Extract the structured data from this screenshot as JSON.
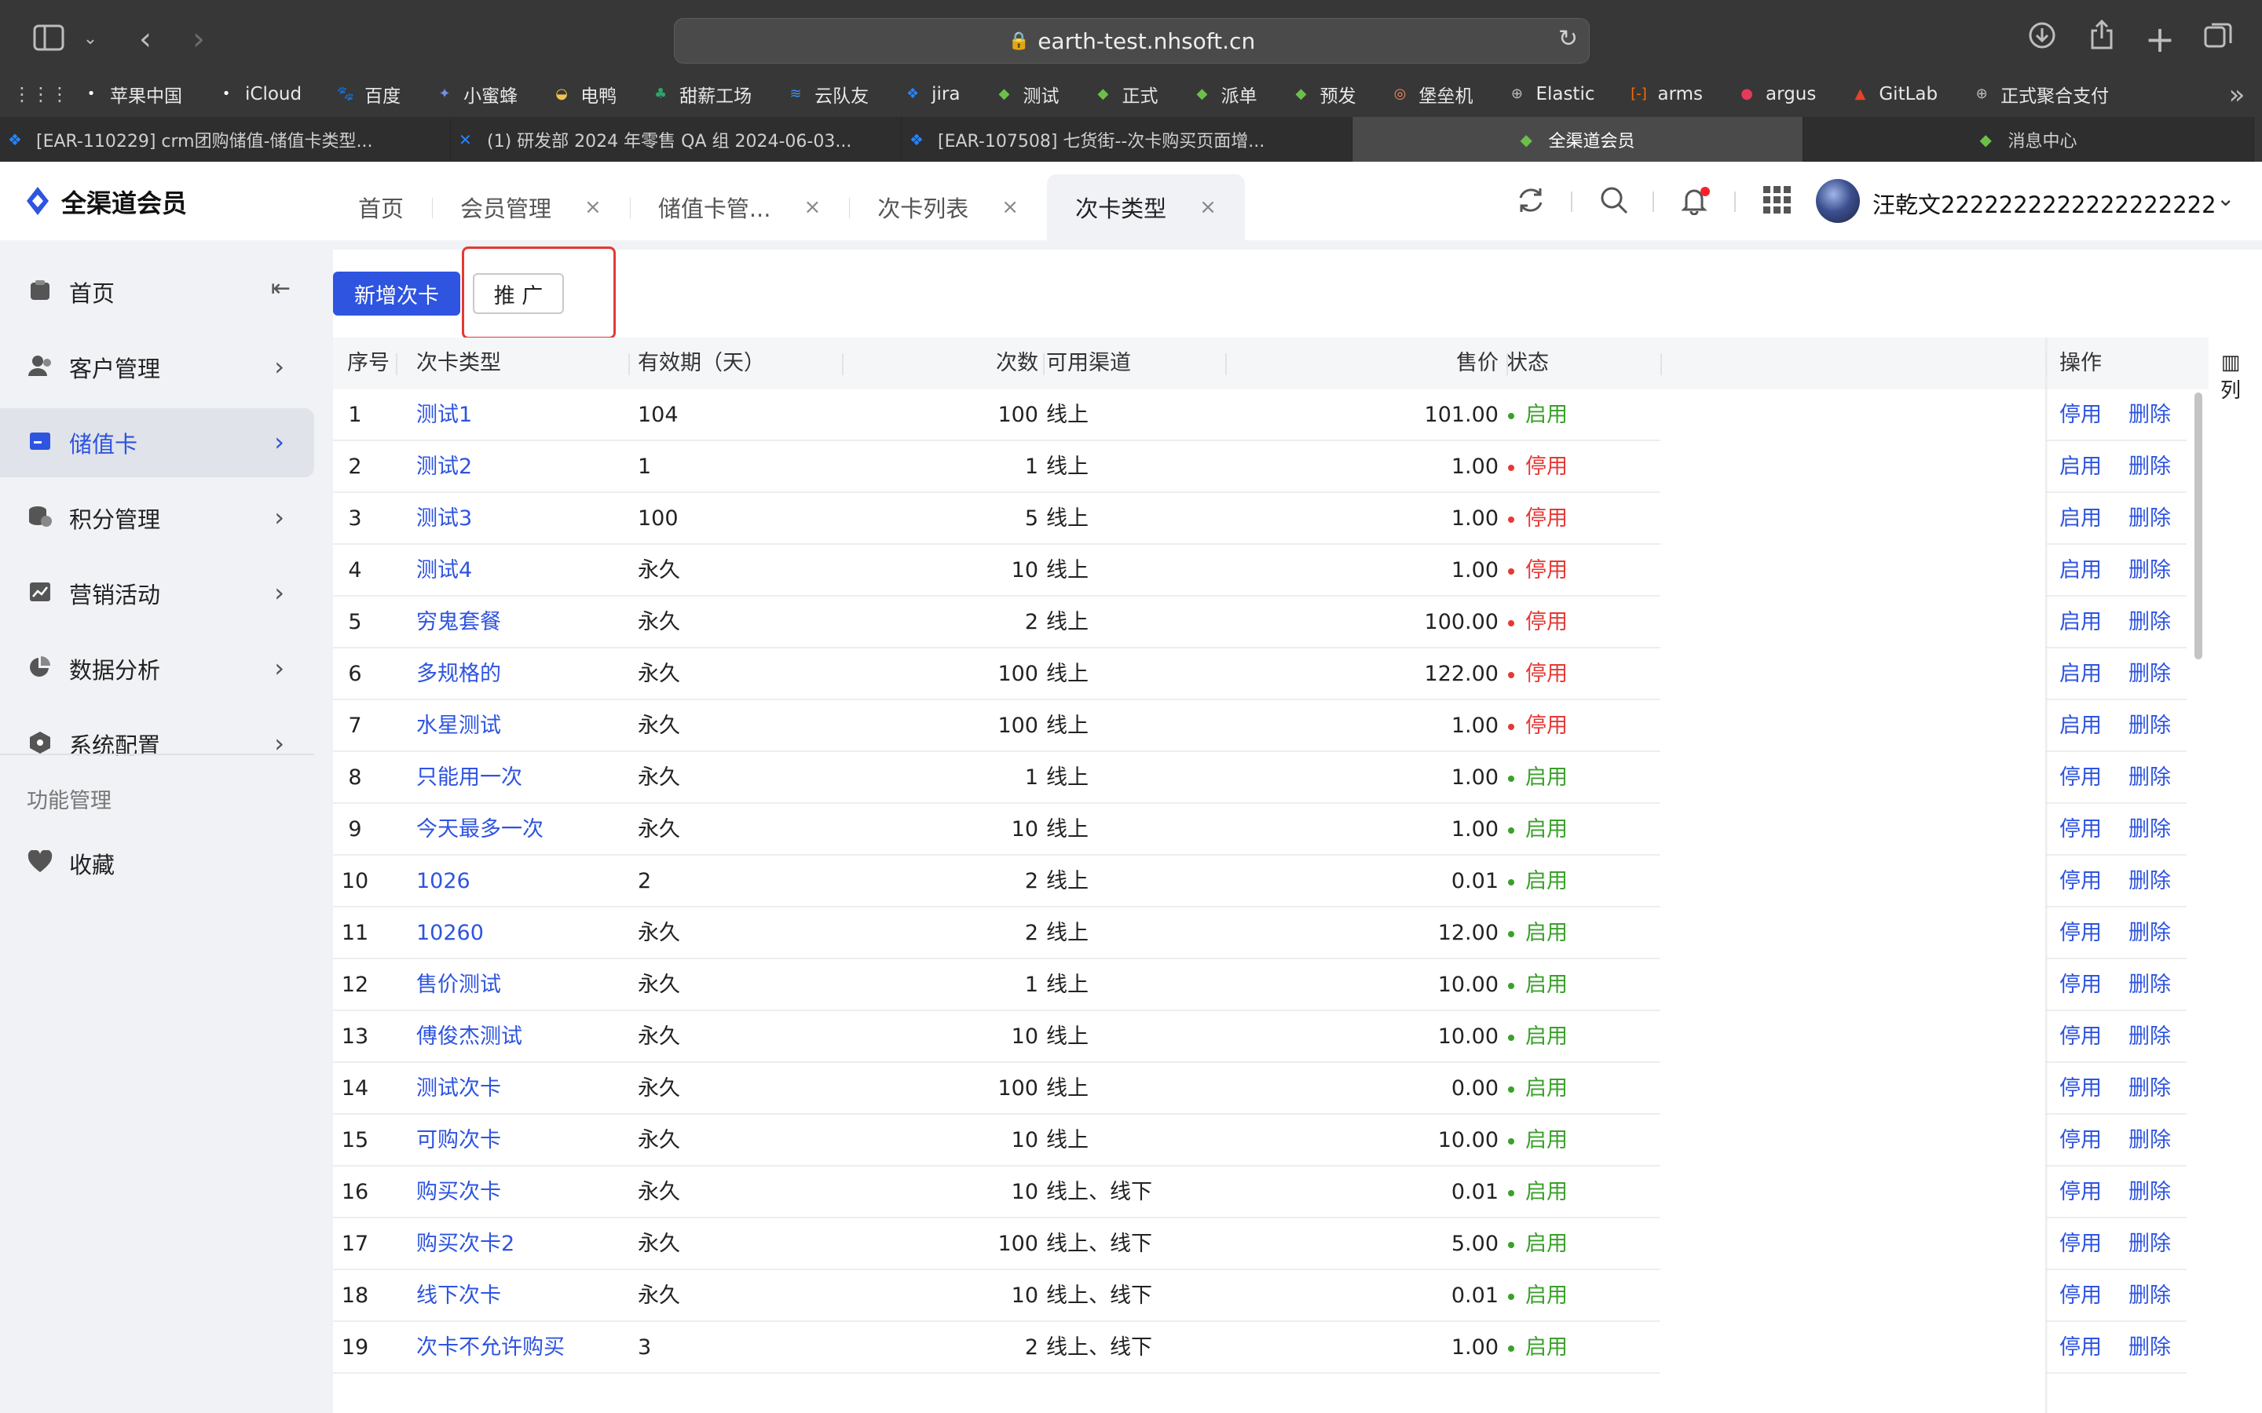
{
  "browser": {
    "url": "earth-test.nhsoft.cn",
    "bookmarks": [
      {
        "label": "苹果中国",
        "icon": "apple-icon",
        "color": "#ffffff"
      },
      {
        "label": "iCloud",
        "icon": "apple-icon",
        "color": "#ffffff"
      },
      {
        "label": "百度",
        "icon": "baidu-icon",
        "color": "#3e6bff"
      },
      {
        "label": "小蜜蜂",
        "icon": "bee-icon",
        "color": "#6f8fe8"
      },
      {
        "label": "电鸭",
        "icon": "duck-icon",
        "color": "#f2c14e"
      },
      {
        "label": "甜薪工场",
        "icon": "tree-icon",
        "color": "#2fa36b"
      },
      {
        "label": "云队友",
        "icon": "wave-icon",
        "color": "#3e8ef7"
      },
      {
        "label": "jira",
        "icon": "jira-icon",
        "color": "#2684ff"
      },
      {
        "label": "测试",
        "icon": "diamond-icon",
        "color": "#6cc04a"
      },
      {
        "label": "正式",
        "icon": "diamond-icon",
        "color": "#6cc04a"
      },
      {
        "label": "派单",
        "icon": "diamond-icon",
        "color": "#6cc04a"
      },
      {
        "label": "预发",
        "icon": "diamond-icon",
        "color": "#6cc04a"
      },
      {
        "label": "堡垒机",
        "icon": "fortress-icon",
        "color": "#f08a5d"
      },
      {
        "label": "Elastic",
        "icon": "globe-icon",
        "color": "#bdbdbd"
      },
      {
        "label": "arms",
        "icon": "bracket-icon",
        "color": "#ff6a00"
      },
      {
        "label": "argus",
        "icon": "argus-icon",
        "color": "#e63a5a"
      },
      {
        "label": "GitLab",
        "icon": "gitlab-icon",
        "color": "#e24329"
      },
      {
        "label": "正式聚合支付",
        "icon": "globe-icon",
        "color": "#bdbdbd"
      }
    ],
    "tabs": [
      {
        "label": "[EAR-110229] crm团购储值-储值卡类型...",
        "icon": "jira-icon"
      },
      {
        "label": "(1) 研发部 2024 年零售 QA 组 2024-06-03...",
        "icon": "confluence-icon"
      },
      {
        "label": "[EAR-107508] 七货街--次卡购买页面增...",
        "icon": "jira-icon"
      },
      {
        "label": "全渠道会员",
        "icon": "diamond-icon",
        "active": true
      },
      {
        "label": "消息中心",
        "icon": "diamond-icon"
      }
    ]
  },
  "app": {
    "title": "全渠道会员",
    "nav_tabs": [
      {
        "label": "首页",
        "closable": false
      },
      {
        "label": "会员管理",
        "closable": true
      },
      {
        "label": "储值卡管...",
        "closable": true
      },
      {
        "label": "次卡列表",
        "closable": true
      },
      {
        "label": "次卡类型",
        "closable": true,
        "active": true
      }
    ],
    "close_glyph": "×",
    "user": {
      "name": "汪乾文2222222222222222222"
    },
    "accent": "#2e54e0"
  },
  "sidebar": {
    "items": [
      {
        "label": "首页",
        "icon": "home-icon"
      },
      {
        "label": "客户管理",
        "icon": "user-icon"
      },
      {
        "label": "储值卡",
        "icon": "card-icon",
        "active": true
      },
      {
        "label": "积分管理",
        "icon": "coins-icon"
      },
      {
        "label": "营销活动",
        "icon": "chart-icon"
      },
      {
        "label": "数据分析",
        "icon": "pie-icon"
      },
      {
        "label": "系统配置",
        "icon": "hexagon-icon"
      }
    ],
    "section_title": "功能管理",
    "favorites_label": "收藏"
  },
  "toolbar": {
    "add_label": "新增次卡",
    "promote_label": "推 广"
  },
  "table": {
    "columns": [
      "序号",
      "次卡类型",
      "有效期（天）",
      "次数",
      "可用渠道",
      "售价",
      "状态",
      "操作"
    ],
    "column_toggle_label": "列",
    "rows": [
      {
        "no": "1",
        "name": "测试1",
        "validity": "104",
        "times": "100",
        "channel": "线上",
        "price": "101.00",
        "status": "启用",
        "enabled": true
      },
      {
        "no": "2",
        "name": "测试2",
        "validity": "1",
        "times": "1",
        "channel": "线上",
        "price": "1.00",
        "status": "停用",
        "enabled": false
      },
      {
        "no": "3",
        "name": "测试3",
        "validity": "100",
        "times": "5",
        "channel": "线上",
        "price": "1.00",
        "status": "停用",
        "enabled": false
      },
      {
        "no": "4",
        "name": "测试4",
        "validity": "永久",
        "times": "10",
        "channel": "线上",
        "price": "1.00",
        "status": "停用",
        "enabled": false
      },
      {
        "no": "5",
        "name": "穷鬼套餐",
        "validity": "永久",
        "times": "2",
        "channel": "线上",
        "price": "100.00",
        "status": "停用",
        "enabled": false
      },
      {
        "no": "6",
        "name": "多规格的",
        "validity": "永久",
        "times": "100",
        "channel": "线上",
        "price": "122.00",
        "status": "停用",
        "enabled": false
      },
      {
        "no": "7",
        "name": "水星测试",
        "validity": "永久",
        "times": "100",
        "channel": "线上",
        "price": "1.00",
        "status": "停用",
        "enabled": false
      },
      {
        "no": "8",
        "name": "只能用一次",
        "validity": "永久",
        "times": "1",
        "channel": "线上",
        "price": "1.00",
        "status": "启用",
        "enabled": true
      },
      {
        "no": "9",
        "name": "今天最多一次",
        "validity": "永久",
        "times": "10",
        "channel": "线上",
        "price": "1.00",
        "status": "启用",
        "enabled": true
      },
      {
        "no": "10",
        "name": "1026",
        "validity": "2",
        "times": "2",
        "channel": "线上",
        "price": "0.01",
        "status": "启用",
        "enabled": true
      },
      {
        "no": "11",
        "name": "10260",
        "validity": "永久",
        "times": "2",
        "channel": "线上",
        "price": "12.00",
        "status": "启用",
        "enabled": true
      },
      {
        "no": "12",
        "name": "售价测试",
        "validity": "永久",
        "times": "1",
        "channel": "线上",
        "price": "10.00",
        "status": "启用",
        "enabled": true
      },
      {
        "no": "13",
        "name": "傅俊杰测试",
        "validity": "永久",
        "times": "10",
        "channel": "线上",
        "price": "10.00",
        "status": "启用",
        "enabled": true
      },
      {
        "no": "14",
        "name": "测试次卡",
        "validity": "永久",
        "times": "100",
        "channel": "线上",
        "price": "0.00",
        "status": "启用",
        "enabled": true
      },
      {
        "no": "15",
        "name": "可购次卡",
        "validity": "永久",
        "times": "10",
        "channel": "线上",
        "price": "10.00",
        "status": "启用",
        "enabled": true
      },
      {
        "no": "16",
        "name": "购买次卡",
        "validity": "永久",
        "times": "10",
        "channel": "线上、线下",
        "price": "0.01",
        "status": "启用",
        "enabled": true
      },
      {
        "no": "17",
        "name": "购买次卡2",
        "validity": "永久",
        "times": "100",
        "channel": "线上、线下",
        "price": "5.00",
        "status": "启用",
        "enabled": true
      },
      {
        "no": "18",
        "name": "线下次卡",
        "validity": "永久",
        "times": "10",
        "channel": "线上、线下",
        "price": "0.01",
        "status": "启用",
        "enabled": true
      },
      {
        "no": "19",
        "name": "次卡不允许购买",
        "validity": "3",
        "times": "2",
        "channel": "线上、线下",
        "price": "1.00",
        "status": "启用",
        "enabled": true
      }
    ],
    "actions": {
      "enable": "启用",
      "disable": "停用",
      "delete": "删除"
    }
  }
}
